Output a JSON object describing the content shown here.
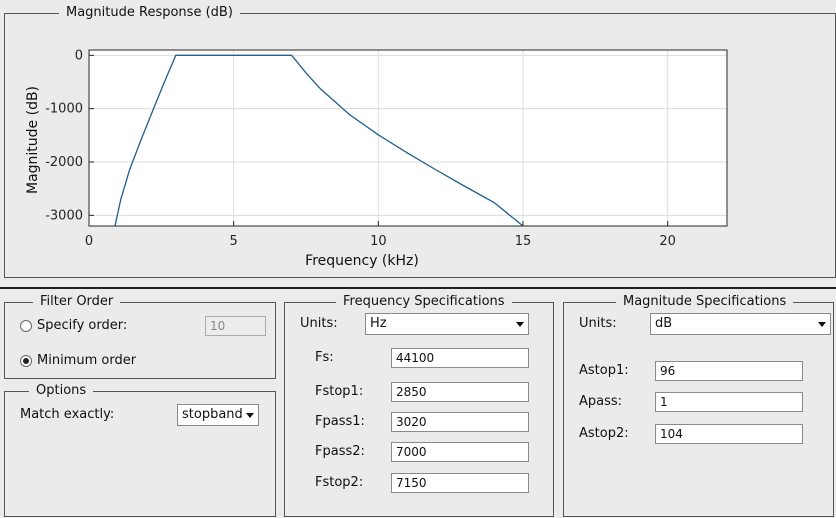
{
  "plot": {
    "title": "Magnitude Response (dB)",
    "chart_data": {
      "type": "line",
      "xlabel": "Frequency (kHz)",
      "ylabel": "Magnitude (dB)",
      "xlim": [
        0,
        22.05
      ],
      "ylim": [
        -3200,
        100
      ],
      "xticks": [
        0,
        5,
        10,
        15,
        20
      ],
      "yticks": [
        0,
        -1000,
        -2000,
        -3000
      ],
      "grid": true,
      "line_color": "#1f5f8b",
      "series": [
        {
          "x": [
            0.9,
            1.1,
            1.4,
            1.8,
            2.2,
            2.6,
            3.0,
            3.5,
            4.5,
            5.5,
            6.5,
            7.0,
            7.15,
            7.5,
            8.0,
            9.0,
            10.0,
            11.0,
            12.0,
            13.0,
            14.0,
            15.0
          ],
          "y": [
            -3200,
            -2700,
            -2150,
            -1580,
            -1040,
            -510,
            0,
            0,
            0,
            0,
            0,
            0,
            -95,
            -330,
            -630,
            -1110,
            -1490,
            -1830,
            -2150,
            -2460,
            -2760,
            -3200
          ]
        }
      ]
    }
  },
  "filter_order": {
    "title": "Filter Order",
    "specify_label": "Specify order:",
    "order_value": "10",
    "minimum_label": "Minimum order"
  },
  "options": {
    "title": "Options",
    "match_label": "Match exactly:",
    "match_value": "stopband"
  },
  "freq_specs": {
    "title": "Frequency Specifications",
    "units_label": "Units:",
    "units_value": "Hz",
    "fields": [
      {
        "label": "Fs:",
        "value": "44100"
      },
      {
        "label": "Fstop1:",
        "value": "2850"
      },
      {
        "label": "Fpass1:",
        "value": "3020"
      },
      {
        "label": "Fpass2:",
        "value": "7000"
      },
      {
        "label": "Fstop2:",
        "value": "7150"
      }
    ]
  },
  "mag_specs": {
    "title": "Magnitude Specifications",
    "units_label": "Units:",
    "units_value": "dB",
    "fields": [
      {
        "label": "Astop1:",
        "value": "96"
      },
      {
        "label": "Apass:",
        "value": "1"
      },
      {
        "label": "Astop2:",
        "value": "104"
      }
    ]
  }
}
